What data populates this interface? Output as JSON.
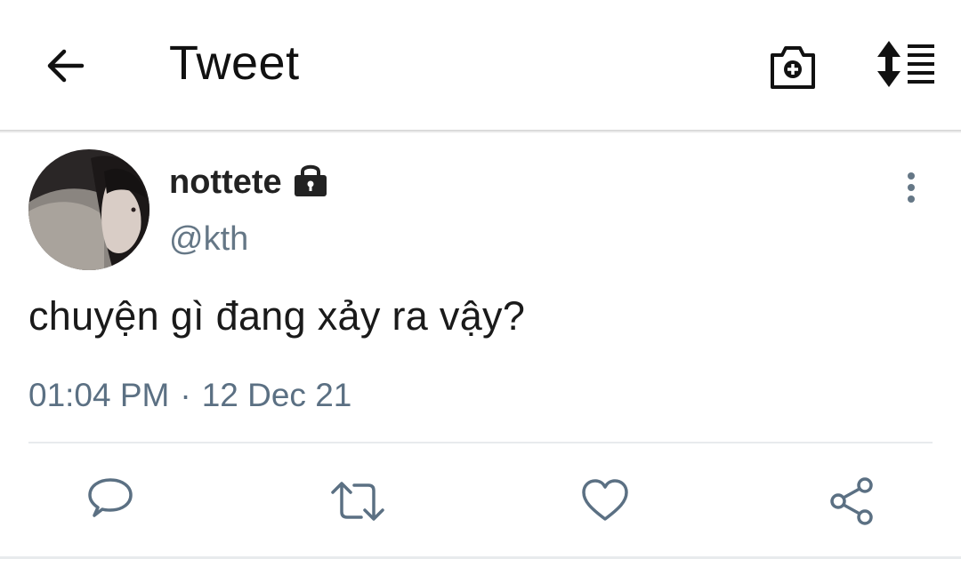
{
  "header": {
    "title": "Tweet",
    "icons": [
      "back-arrow-icon",
      "camera-plus-icon",
      "sort-list-icon"
    ]
  },
  "tweet": {
    "display_name": "nottete",
    "handle": "@kth",
    "protected_icon": "lock-icon",
    "text": "chuyện gì đang xảy ra vậy?",
    "time": "01:04 PM",
    "separator": "·",
    "date": "12 Dec 21"
  },
  "actions": [
    "reply-icon",
    "retweet-icon",
    "like-icon",
    "share-icon"
  ],
  "colors": {
    "text": "#1a1a1a",
    "secondary": "#657786",
    "action_icons": "#5b7083",
    "divider": "#e8ebed"
  }
}
